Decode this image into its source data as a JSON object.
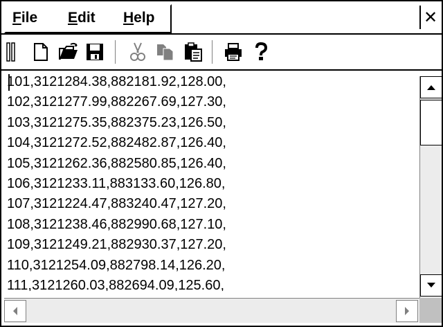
{
  "menu": {
    "file": {
      "underline": "F",
      "rest": "ile"
    },
    "edit": {
      "underline": "E",
      "rest": "dit"
    },
    "help": {
      "underline": "H",
      "rest": "elp"
    },
    "close_glyph": "✕"
  },
  "toolbar": {
    "icons": [
      "grip-handle-icon",
      "new-document-icon",
      "open-folder-icon",
      "save-icon",
      "cut-icon",
      "copy-icon",
      "paste-icon",
      "print-icon",
      "help-icon"
    ]
  },
  "editor": {
    "lines": [
      "101,3121284.38,882181.92,128.00,",
      "102,3121277.99,882267.69,127.30,",
      "103,3121275.35,882375.23,126.50,",
      "104,3121272.52,882482.87,126.40,",
      "105,3121262.36,882580.85,126.40,",
      "106,3121233.11,883133.60,126.80,",
      "107,3121224.47,883240.47,127.20,",
      "108,3121238.46,882990.68,127.10,",
      "109,3121249.21,882930.37,127.20,",
      "110,3121254.09,882798.14,126.20,",
      "111,3121260.03,882694.09,125.60,"
    ]
  },
  "colors": {
    "background": "#ffffff",
    "scrollbar_track": "#ececec",
    "border": "#000000"
  }
}
